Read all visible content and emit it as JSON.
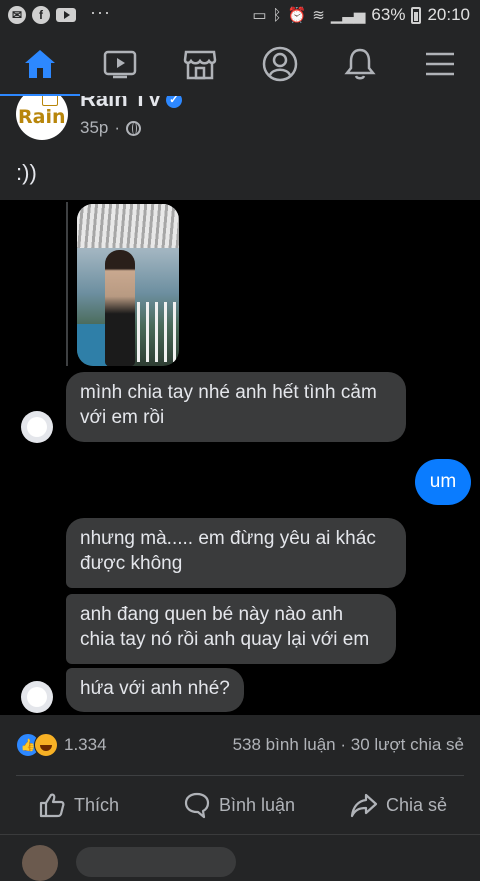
{
  "status_bar": {
    "messenger_icon": "messenger-icon",
    "facebook_icon": "facebook-icon",
    "youtube_icon": "youtube-icon",
    "more": "···",
    "battery": "63%",
    "time": "20:10"
  },
  "nav": {
    "items": [
      "home-icon",
      "watch-icon",
      "marketplace-icon",
      "profile-icon",
      "notifications-icon",
      "menu-icon"
    ],
    "active_color": "#2d88ff"
  },
  "post": {
    "page_name": "Rain TV",
    "avatar_text": "Rain",
    "verified": "✓",
    "time": "35p",
    "text": ":))"
  },
  "chat": {
    "messages": [
      "mình chia tay nhé anh hết tình cảm với em rồi",
      "um",
      "nhưng mà..... em đừng yêu ai khác được không",
      "anh đang quen bé này nào anh chia tay nó rồi anh quay lại với em",
      "hứa với anh nhé?"
    ]
  },
  "reactions": {
    "count": "1.334",
    "engagement": "538 bình luận · 30 lượt chia sẻ",
    "like_color": "#2d88ff",
    "haha_color": "#f7b125"
  },
  "actions": {
    "like": "Thích",
    "comment": "Bình luận",
    "share": "Chia sẻ"
  }
}
